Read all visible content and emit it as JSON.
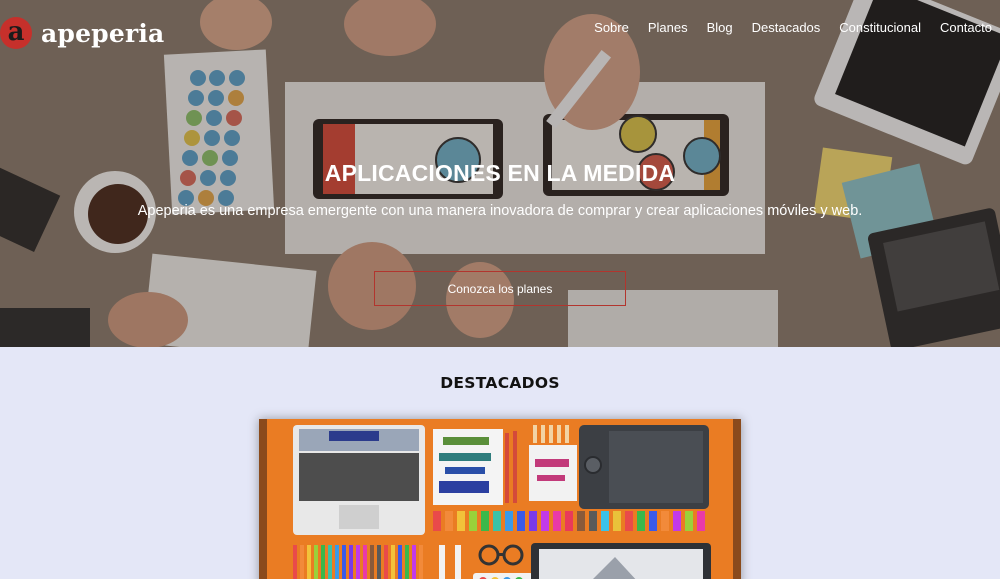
{
  "header": {
    "brand_letter": "a",
    "brand_name": "apeperia",
    "nav": [
      "Sobre",
      "Planes",
      "Blog",
      "Destacados",
      "Constitucional",
      "Contacto"
    ]
  },
  "hero": {
    "title": "APLICACIONES EN LA MEDIDA",
    "subtitle": "Apeperia es una empresa emergente con una manera inovadora de comprar y crear aplicaciones móviles y web.",
    "cta_label": "Conozca los planes"
  },
  "featured": {
    "title": "DESTACADOS"
  },
  "colors": {
    "brand_red": "#c6302b",
    "section_bg": "#e4e7f7",
    "card_orange": "#ea7c23"
  }
}
